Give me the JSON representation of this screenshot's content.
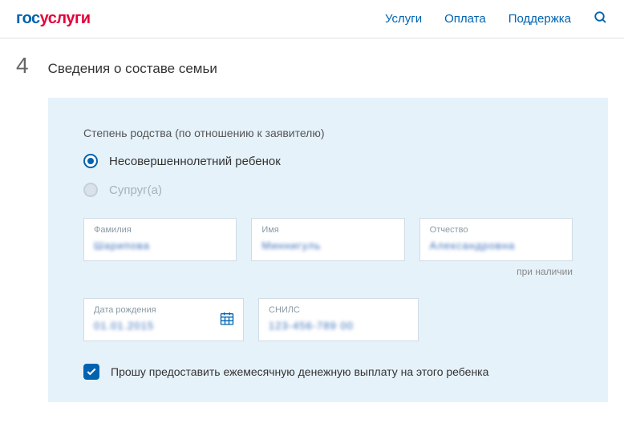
{
  "header": {
    "logo_gos": "гос",
    "logo_uslugi": "услуги",
    "nav": {
      "services": "Услуги",
      "payment": "Оплата",
      "support": "Поддержка"
    }
  },
  "step": {
    "number": "4",
    "title": "Сведения о составе семьи"
  },
  "form": {
    "relation_label": "Степень родства (по отношению к заявителю)",
    "options": {
      "child": "Несовершеннолетний ребенок",
      "spouse": "Супруг(а)"
    },
    "fields": {
      "surname": {
        "label": "Фамилия",
        "value": "Шарипова"
      },
      "firstname": {
        "label": "Имя",
        "value": "Миннигуль"
      },
      "patronymic": {
        "label": "Отчество",
        "value": "Александровна"
      },
      "birthdate": {
        "label": "Дата рождения",
        "value": "01.01.2015"
      },
      "snils": {
        "label": "СНИЛС",
        "value": "123-456-789 00"
      }
    },
    "hint": "при наличии",
    "checkbox_label": "Прошу предоставить ежемесячную денежную выплату на этого ребенка"
  }
}
